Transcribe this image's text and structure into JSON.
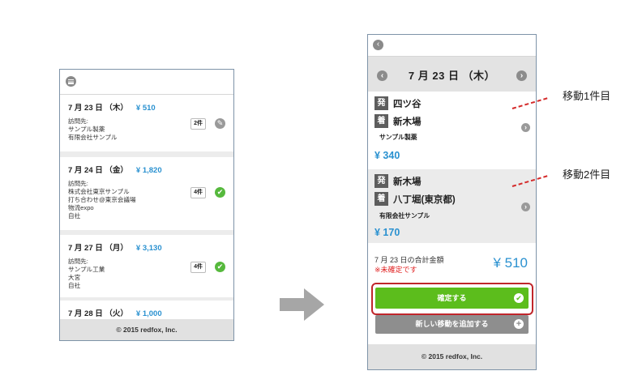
{
  "left_phone": {
    "days": [
      {
        "date": "7 月 23 日 （木）",
        "amount": "¥ 510",
        "detail": [
          "訪問先:",
          "サンプル製薬",
          "有限会社サンプル"
        ],
        "count": "2件",
        "status_icon": "pencil-icon"
      },
      {
        "date": "7 月 24 日 （金）",
        "amount": "¥ 1,820",
        "detail": [
          "訪問先:",
          "株式会社東京サンプル",
          "打ち合わせ@東京会議場",
          "物流expo",
          "自社"
        ],
        "count": "4件",
        "status_icon": "check-icon"
      },
      {
        "date": "7 月 27 日 （月）",
        "amount": "¥ 3,130",
        "detail": [
          "訪問先:",
          "サンプル工業",
          "大宮",
          "自社"
        ],
        "count": "4件",
        "status_icon": "check-icon"
      },
      {
        "date": "7 月 28 日 （火）",
        "amount": "¥ 1,000"
      }
    ],
    "footer": "© 2015 redfox, Inc."
  },
  "right_phone": {
    "date_title": "7 月 23 日 （木）",
    "trips": [
      {
        "from_tag": "発",
        "from": "四ツ谷",
        "to_tag": "着",
        "to": "新木場",
        "company": "サンプル製薬",
        "amount": "¥ 340"
      },
      {
        "from_tag": "発",
        "from": "新木場",
        "to_tag": "着",
        "to": "八丁堀(東京都)",
        "company": "有限会社サンプル",
        "amount": "¥ 170"
      }
    ],
    "total_label": "7 月 23 日の合計金額",
    "total_note": "※未確定です",
    "total_value": "¥ 510",
    "confirm_label": "確定する",
    "add_label": "新しい移動を追加する",
    "footer": "© 2015 redfox, Inc."
  },
  "annotations": [
    "移動1件目",
    "移動2件目"
  ],
  "colors": {
    "accent_blue": "#2a91d0",
    "confirm_green": "#5cbd1c",
    "highlight_red": "#c0262b",
    "warning_red": "#e02020"
  }
}
